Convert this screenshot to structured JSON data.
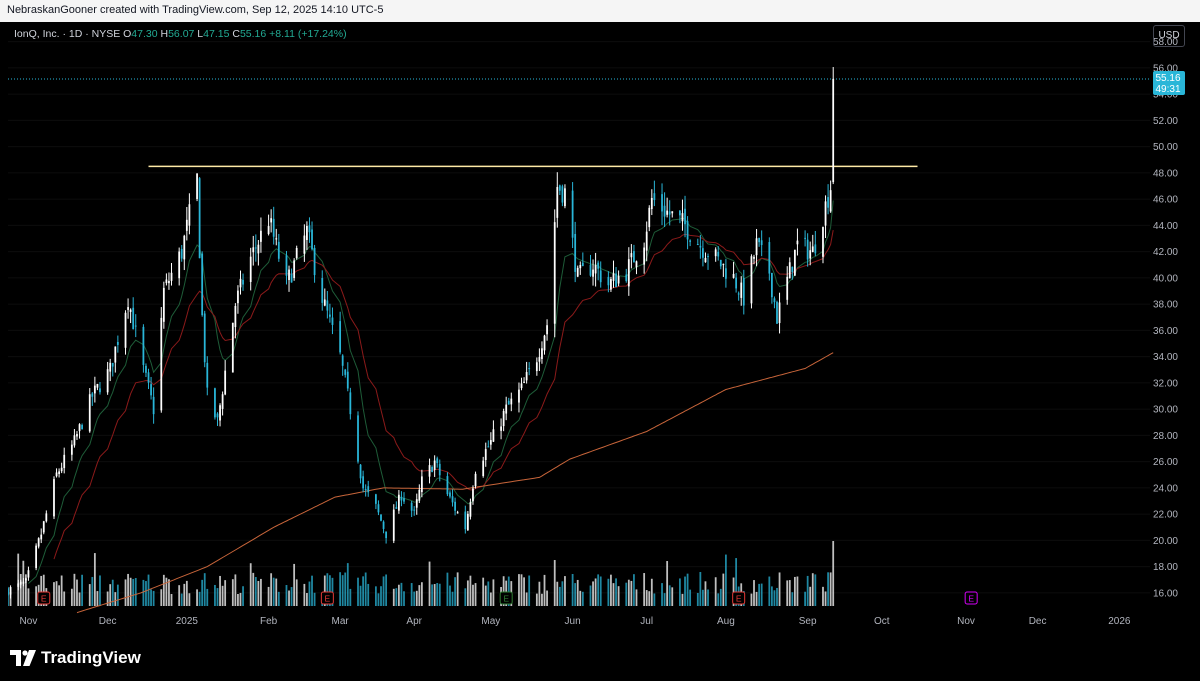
{
  "header": {
    "credit": "NebraskanGooner created with TradingView.com, Sep 12, 2025 14:10 UTC-5"
  },
  "legend": {
    "symbol": "IonQ, Inc. · 1D · NYSE",
    "open_label": "O",
    "open": "47.30",
    "high_label": "H",
    "high": "56.07",
    "low_label": "L",
    "low": "47.15",
    "close_label": "C",
    "close": "55.16",
    "change": "+8.11 (+17.24%)"
  },
  "toolbar": {
    "currency": "USD"
  },
  "price_tag": {
    "price": "55.16",
    "countdown": "49:31"
  },
  "footer": {
    "brand": "TradingView"
  },
  "colors": {
    "up": "#ffffff",
    "down": "#29b6d8",
    "ema_fast": "#1e5c38",
    "ema_mid": "#8b1a1a",
    "sma_slow": "#c8653a",
    "hline": "#ffeaa7",
    "price_tag_bg": "#29b6d8",
    "event_earnings": "#e53935",
    "event_dividend": "#2e7d32",
    "event_future": "#d500f9"
  },
  "icons": {
    "event_marker": "earnings-e-icon",
    "brand_logo": "tradingview-logo-icon"
  },
  "chart_data": {
    "type": "candlestick",
    "title": "IonQ, Inc. · 1D · NYSE",
    "y_ticks": [
      "16.00",
      "18.00",
      "20.00",
      "22.00",
      "24.00",
      "26.00",
      "28.00",
      "30.00",
      "32.00",
      "34.00",
      "36.00",
      "38.00",
      "40.00",
      "42.00",
      "44.00",
      "46.00",
      "48.00",
      "50.00",
      "52.00",
      "54.00",
      "56.00",
      "58.00"
    ],
    "ylim": [
      15.0,
      59.5
    ],
    "x_ticks": [
      "Nov",
      "Dec",
      "2025",
      "Feb",
      "Mar",
      "Apr",
      "May",
      "Jun",
      "Jul",
      "Aug",
      "Sep",
      "Oct",
      "Nov",
      "Dec",
      "2026"
    ],
    "x_tick_dates": [
      "2024-11-01",
      "2024-12-02",
      "2025-01-02",
      "2025-02-03",
      "2025-03-03",
      "2025-04-01",
      "2025-05-01",
      "2025-06-02",
      "2025-07-01",
      "2025-08-01",
      "2025-09-02",
      "2025-10-01",
      "2025-11-03",
      "2025-12-01",
      "2026-01-02"
    ],
    "xlim": [
      "2024-10-24",
      "2026-01-14"
    ],
    "horizontal_line": 48.5,
    "last_price": 55.16,
    "close_anchors": [
      [
        "2024-10-24",
        16.2
      ],
      [
        "2024-10-31",
        16.8
      ],
      [
        "2024-11-06",
        20.5
      ],
      [
        "2024-11-12",
        25.0
      ],
      [
        "2024-11-19",
        27.5
      ],
      [
        "2024-11-26",
        31.0
      ],
      [
        "2024-12-03",
        33.0
      ],
      [
        "2024-12-10",
        38.5
      ],
      [
        "2024-12-16",
        33.0
      ],
      [
        "2024-12-20",
        30.0
      ],
      [
        "2024-12-24",
        39.0
      ],
      [
        "2024-12-31",
        42.0
      ],
      [
        "2025-01-06",
        47.5
      ],
      [
        "2025-01-08",
        37.0
      ],
      [
        "2025-01-10",
        31.0
      ],
      [
        "2025-01-14",
        29.0
      ],
      [
        "2025-01-21",
        38.0
      ],
      [
        "2025-01-27",
        41.5
      ],
      [
        "2025-02-03",
        44.5
      ],
      [
        "2025-02-10",
        39.5
      ],
      [
        "2025-02-18",
        43.5
      ],
      [
        "2025-02-24",
        38.5
      ],
      [
        "2025-03-03",
        34.0
      ],
      [
        "2025-03-07",
        30.0
      ],
      [
        "2025-03-12",
        24.0
      ],
      [
        "2025-03-17",
        22.5
      ],
      [
        "2025-03-21",
        20.5
      ],
      [
        "2025-03-27",
        23.5
      ],
      [
        "2025-04-01",
        22.0
      ],
      [
        "2025-04-04",
        24.5
      ],
      [
        "2025-04-09",
        26.0
      ],
      [
        "2025-04-14",
        23.5
      ],
      [
        "2025-04-21",
        21.0
      ],
      [
        "2025-04-25",
        25.5
      ],
      [
        "2025-05-01",
        27.5
      ],
      [
        "2025-05-07",
        30.0
      ],
      [
        "2025-05-13",
        31.5
      ],
      [
        "2025-05-19",
        34.0
      ],
      [
        "2025-05-23",
        36.5
      ],
      [
        "2025-05-27",
        47.0
      ],
      [
        "2025-05-30",
        46.5
      ],
      [
        "2025-06-04",
        40.0
      ],
      [
        "2025-06-10",
        41.0
      ],
      [
        "2025-06-16",
        39.5
      ],
      [
        "2025-06-23",
        40.5
      ],
      [
        "2025-06-30",
        43.0
      ],
      [
        "2025-07-03",
        46.0
      ],
      [
        "2025-07-09",
        45.0
      ],
      [
        "2025-07-16",
        44.0
      ],
      [
        "2025-07-22",
        42.5
      ],
      [
        "2025-07-28",
        41.5
      ],
      [
        "2025-08-04",
        40.0
      ],
      [
        "2025-08-08",
        38.5
      ],
      [
        "2025-08-13",
        42.5
      ],
      [
        "2025-08-18",
        40.5
      ],
      [
        "2025-08-21",
        37.0
      ],
      [
        "2025-08-26",
        40.5
      ],
      [
        "2025-08-29",
        42.5
      ],
      [
        "2025-09-04",
        42.0
      ],
      [
        "2025-09-09",
        45.5
      ],
      [
        "2025-09-11",
        47.0
      ]
    ],
    "final_bar": {
      "date": "2025-09-12",
      "open": 47.3,
      "high": 56.07,
      "low": 47.15,
      "close": 55.16
    },
    "sma_slow_anchors": [
      [
        "2024-11-20",
        14.5
      ],
      [
        "2024-12-15",
        16.0
      ],
      [
        "2025-01-10",
        18.0
      ],
      [
        "2025-02-05",
        21.0
      ],
      [
        "2025-03-01",
        23.3
      ],
      [
        "2025-03-20",
        24.0
      ],
      [
        "2025-04-20",
        23.9
      ],
      [
        "2025-05-20",
        24.8
      ],
      [
        "2025-06-01",
        26.2
      ],
      [
        "2025-07-01",
        28.3
      ],
      [
        "2025-08-01",
        31.5
      ],
      [
        "2025-09-01",
        33.1
      ],
      [
        "2025-09-12",
        34.3
      ]
    ],
    "event_markers": [
      {
        "date": "2024-11-07",
        "kind": "earnings",
        "label": "E"
      },
      {
        "date": "2025-02-26",
        "kind": "earnings",
        "label": "E"
      },
      {
        "date": "2025-05-07",
        "kind": "dividend",
        "label": "E"
      },
      {
        "date": "2025-08-06",
        "kind": "earnings",
        "label": "E"
      },
      {
        "date": "2025-11-05",
        "kind": "future",
        "label": "E"
      }
    ]
  }
}
